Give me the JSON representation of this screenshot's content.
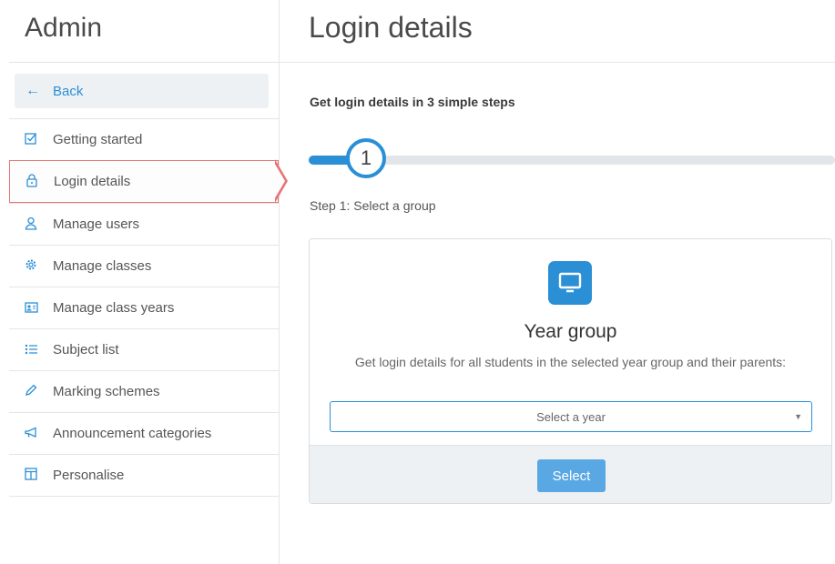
{
  "sidebar": {
    "title": "Admin",
    "back_label": "Back",
    "items": [
      {
        "label": "Getting started",
        "icon": "checkbox-icon"
      },
      {
        "label": "Login details",
        "icon": "lock-icon",
        "active": true
      },
      {
        "label": "Manage users",
        "icon": "user-icon"
      },
      {
        "label": "Manage classes",
        "icon": "gear-icon"
      },
      {
        "label": "Manage class years",
        "icon": "id-card-icon"
      },
      {
        "label": "Subject list",
        "icon": "list-icon"
      },
      {
        "label": "Marking schemes",
        "icon": "pen-icon"
      },
      {
        "label": "Announcement categories",
        "icon": "megaphone-icon"
      },
      {
        "label": "Personalise",
        "icon": "layout-icon"
      }
    ]
  },
  "main": {
    "title": "Login details",
    "steps_heading": "Get login details in 3 simple steps",
    "current_step": "1",
    "progress_fraction": 0.1,
    "step_label": "Step 1: Select a group",
    "card": {
      "title": "Year group",
      "description": "Get login details for all students in the selected year group and their parents:",
      "select_placeholder": "Select a year",
      "button_label": "Select",
      "icon": "monitor-icon"
    }
  },
  "colors": {
    "accent": "#2b8fd6",
    "active_border": "#e87575",
    "button": "#5aa8e3"
  }
}
